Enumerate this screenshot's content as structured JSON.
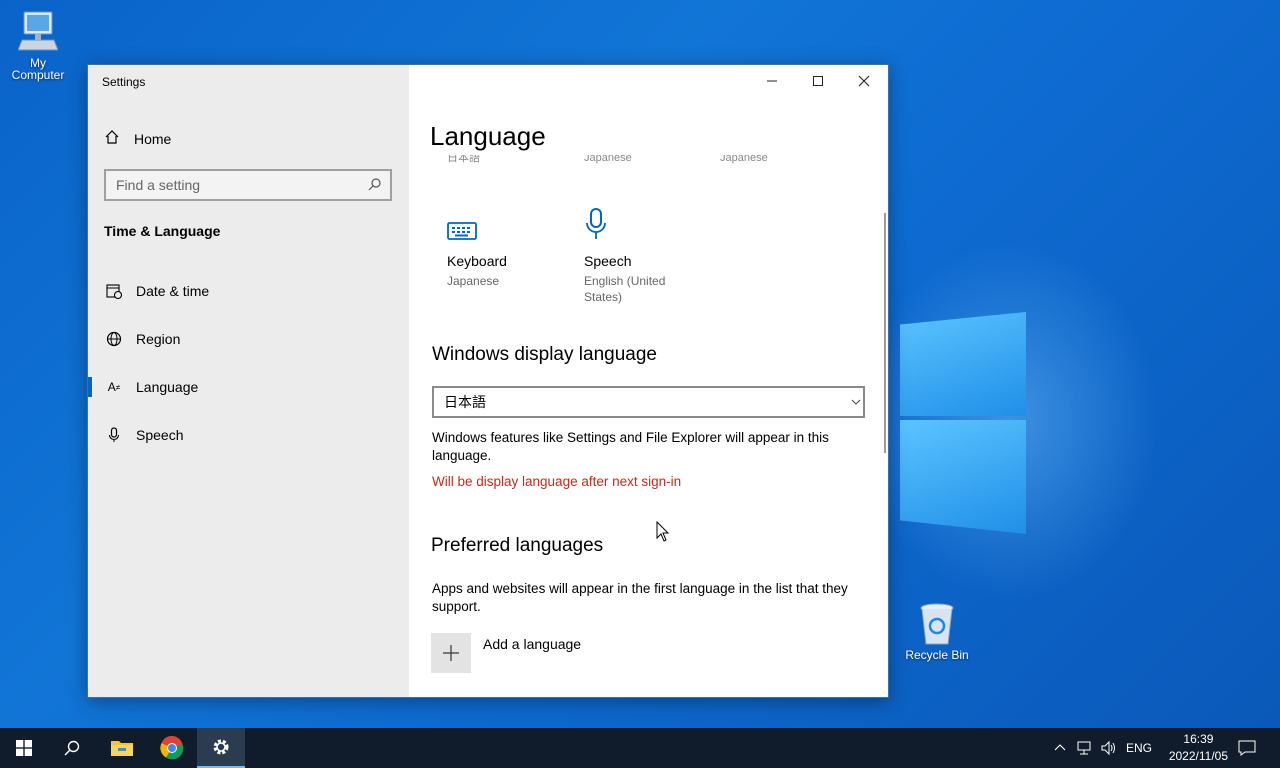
{
  "desktop": {
    "icons": [
      {
        "label_line1": "My",
        "label_line2": "Computer"
      },
      {
        "label_line1": "Recycle Bin"
      }
    ]
  },
  "window": {
    "title": "Settings",
    "sidebar": {
      "home_label": "Home",
      "search_placeholder": "Find a setting",
      "section_title": "Time & Language",
      "items": [
        {
          "label": "Date & time",
          "icon": "calendar-clock-icon"
        },
        {
          "label": "Region",
          "icon": "globe-icon"
        },
        {
          "label": "Language",
          "icon": "language-icon",
          "active": true
        },
        {
          "label": "Speech",
          "icon": "microphone-icon"
        }
      ]
    },
    "content": {
      "title": "Language",
      "cut_row": [
        "日本語",
        "Japanese",
        "Japanese"
      ],
      "features": [
        {
          "title": "Keyboard",
          "sub": "Japanese",
          "icon": "keyboard-icon"
        },
        {
          "title": "Speech",
          "sub": "English (United States)",
          "icon": "microphone-icon"
        }
      ],
      "display_language": {
        "heading": "Windows display language",
        "selected": "日本語",
        "description": "Windows features like Settings and File Explorer will appear in this language.",
        "warning": "Will be display language after next sign-in"
      },
      "preferred": {
        "heading": "Preferred languages",
        "description": "Apps and websites will appear in the first language in the list that they support.",
        "add_label": "Add a language"
      }
    }
  },
  "taskbar": {
    "language": "ENG",
    "time": "16:39",
    "date": "2022/11/05"
  },
  "colors": {
    "accent": "#0067c0",
    "warning": "#c42b1c",
    "taskbar": "#101c2c"
  }
}
